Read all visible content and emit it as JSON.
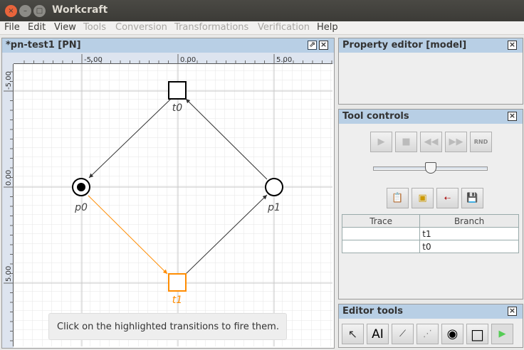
{
  "window": {
    "title": "Workcraft"
  },
  "menu": [
    {
      "label": "File",
      "enabled": true
    },
    {
      "label": "Edit",
      "enabled": true
    },
    {
      "label": "View",
      "enabled": true
    },
    {
      "label": "Tools",
      "enabled": false
    },
    {
      "label": "Conversion",
      "enabled": false
    },
    {
      "label": "Transformations",
      "enabled": false
    },
    {
      "label": "Verification",
      "enabled": false
    },
    {
      "label": "Help",
      "enabled": true
    }
  ],
  "editor": {
    "title": "*pn-test1 [PN]",
    "ruler_x": [
      "-5.00",
      "0.00",
      "5.00"
    ],
    "ruler_y": [
      "-5.00",
      "0.00",
      "5.00"
    ],
    "nodes": {
      "t0": "t0",
      "t1": "t1",
      "p0": "p0",
      "p1": "p1"
    },
    "highlight_color": "#ff8c00",
    "hint": "Click on the highlighted transitions to fire them."
  },
  "property_editor": {
    "title": "Property editor [model]"
  },
  "tool_controls": {
    "title": "Tool controls",
    "slider_value": 0.5,
    "table": {
      "headers": [
        "Trace",
        "Branch"
      ],
      "rows": [
        [
          "",
          "t1"
        ],
        [
          "",
          "t0"
        ]
      ]
    },
    "rnd_label": "RND"
  },
  "editor_tools": {
    "title": "Editor tools",
    "text_tool_label": "AI"
  }
}
